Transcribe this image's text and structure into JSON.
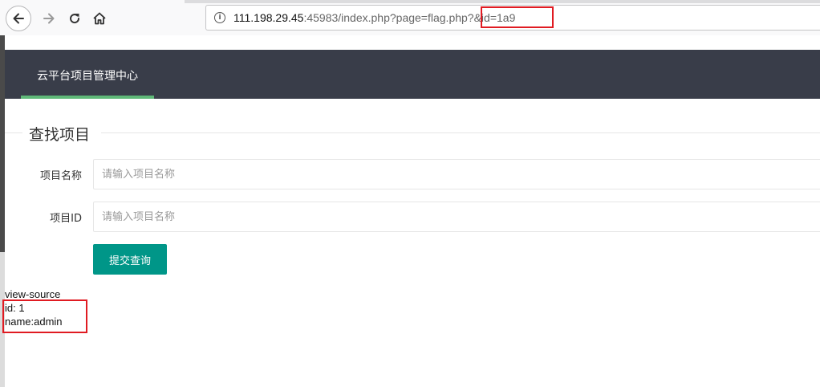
{
  "browser": {
    "url_host": "111.198.29.45",
    "url_rest": ":45983/index.php?page=flag.php?&id=1a9"
  },
  "header": {
    "title": "云平台项目管理中心"
  },
  "form": {
    "legend": "查找项目",
    "name_label": "项目名称",
    "name_placeholder": "请输入项目名称",
    "id_label": "项目ID",
    "id_placeholder": "请输入项目名称",
    "submit_label": "提交查询"
  },
  "result": {
    "line1": "view-source",
    "line2": "id: 1",
    "line3": "name:admin"
  },
  "colors": {
    "header_bg": "#393d49",
    "active_accent": "#5fb878",
    "button": "#009688",
    "highlight": "#e01b22"
  },
  "icons": [
    "back-arrow-icon",
    "forward-arrow-icon",
    "reload-icon",
    "home-icon",
    "info-icon"
  ]
}
